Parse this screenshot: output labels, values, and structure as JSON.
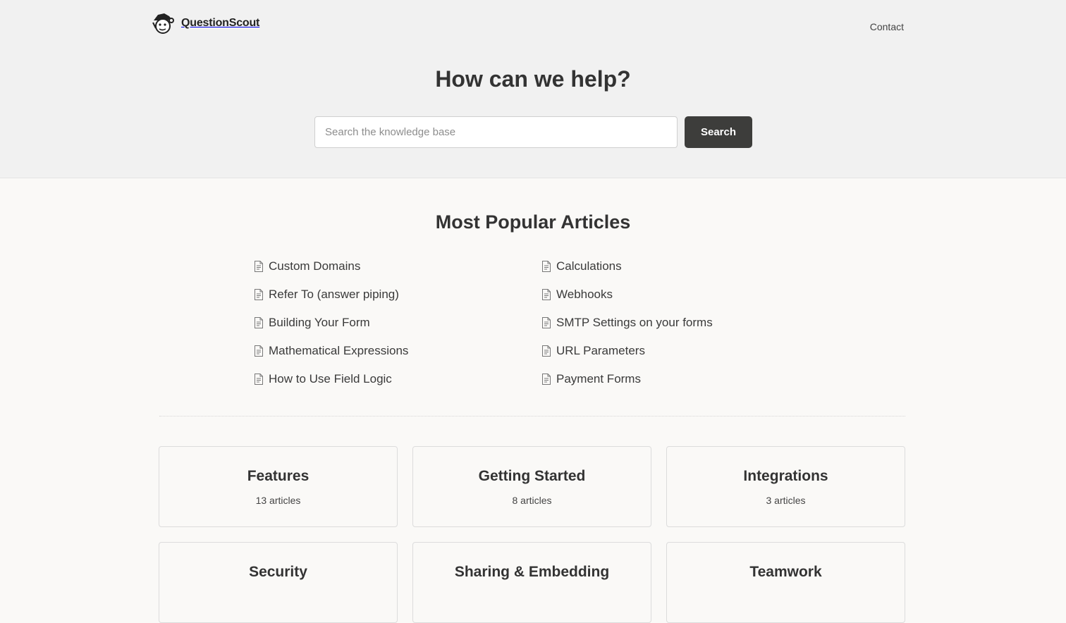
{
  "header": {
    "brand_name": "QuestionScout",
    "logo_icon": "mascot-logo-icon",
    "contact_label": "Contact"
  },
  "hero": {
    "title": "How can we help?",
    "search_placeholder": "Search the knowledge base",
    "search_value": "",
    "search_button_label": "Search"
  },
  "popular": {
    "title": "Most Popular Articles",
    "article_icon": "document-icon",
    "left": [
      {
        "label": "Custom Domains"
      },
      {
        "label": "Refer To (answer piping)"
      },
      {
        "label": "Building Your Form"
      },
      {
        "label": "Mathematical Expressions"
      },
      {
        "label": "How to Use Field Logic"
      }
    ],
    "right": [
      {
        "label": "Calculations"
      },
      {
        "label": "Webhooks"
      },
      {
        "label": "SMTP Settings on your forms"
      },
      {
        "label": "URL Parameters"
      },
      {
        "label": "Payment Forms"
      }
    ]
  },
  "categories": [
    {
      "title": "Features",
      "count": "13 articles"
    },
    {
      "title": "Getting Started",
      "count": "8 articles"
    },
    {
      "title": "Integrations",
      "count": "3 articles"
    },
    {
      "title": "Security",
      "count": ""
    },
    {
      "title": "Sharing & Embedding",
      "count": ""
    },
    {
      "title": "Teamwork",
      "count": ""
    }
  ],
  "colors": {
    "hero_background": "#f1f1f1",
    "page_background": "#faf9f7",
    "button_background": "#3d3d3b",
    "text": "#333333"
  }
}
